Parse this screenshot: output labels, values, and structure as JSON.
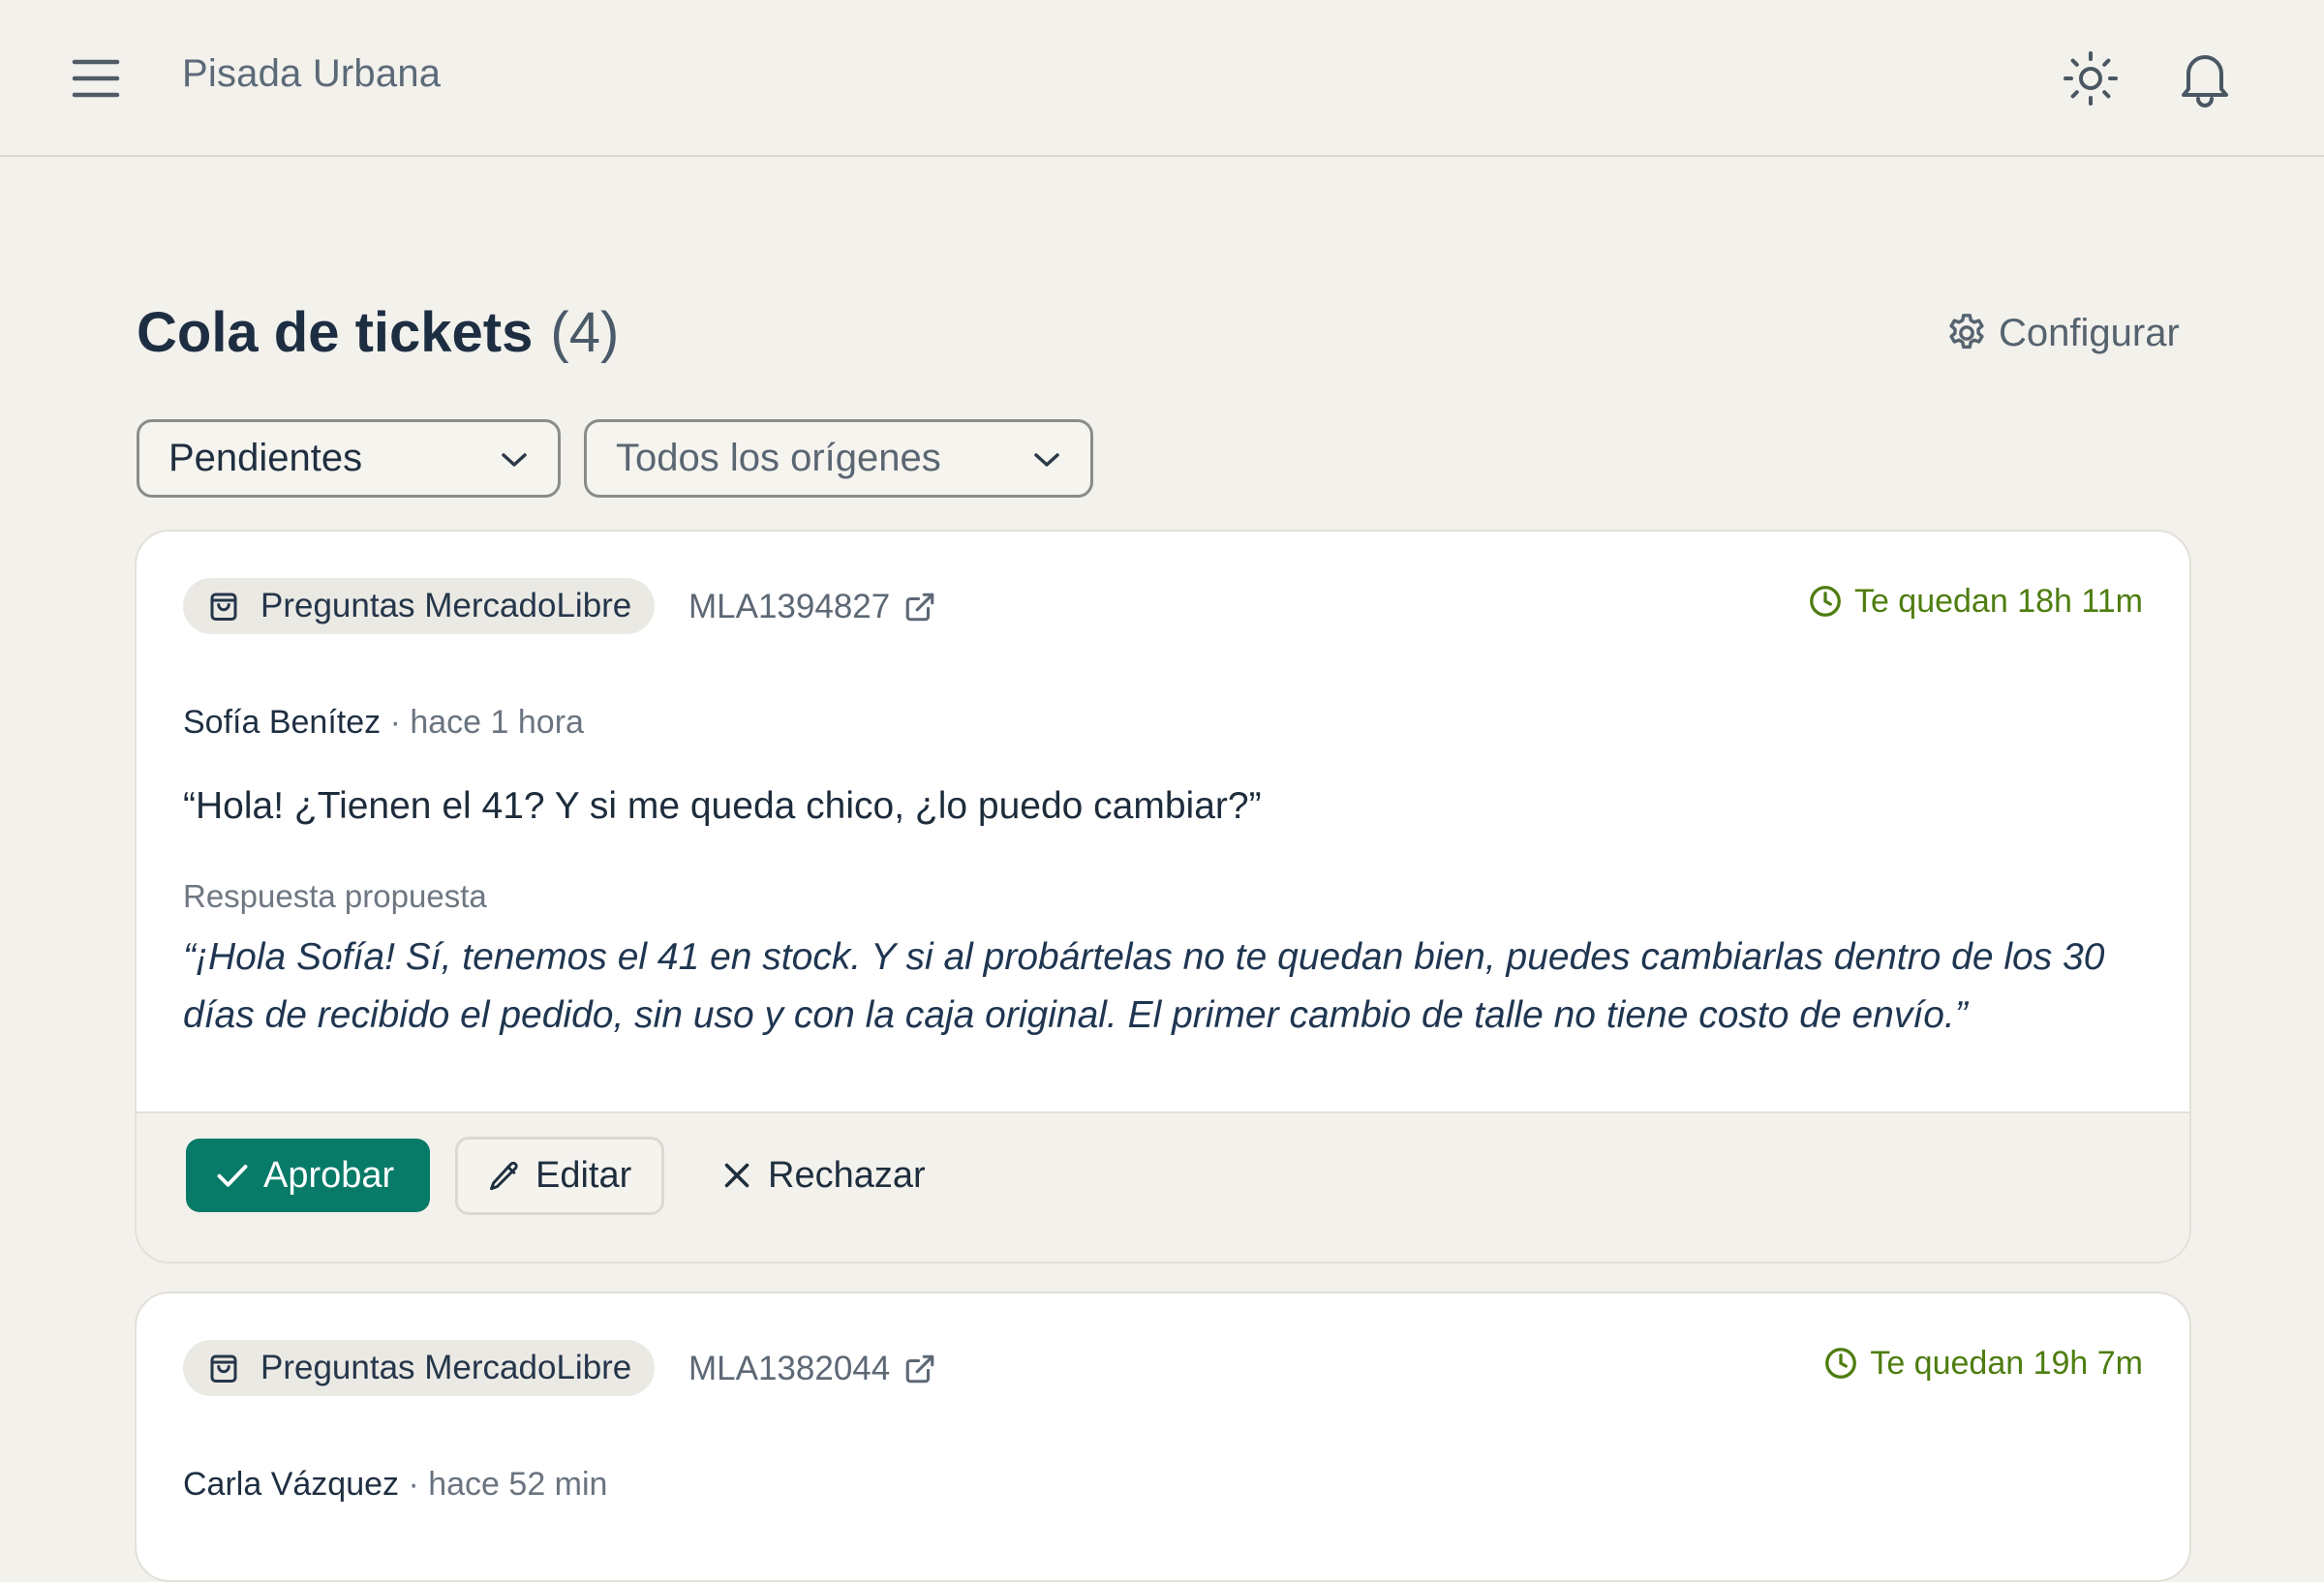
{
  "header": {
    "brand": "Pisada Urbana",
    "icons": [
      "menu-icon",
      "sun-icon",
      "bell-icon"
    ]
  },
  "page": {
    "title": "Cola de tickets",
    "count": "(4)",
    "config_label": "Configurar"
  },
  "filters": {
    "status": "Pendientes",
    "origin": "Todos los orígenes"
  },
  "tickets": [
    {
      "source": "Preguntas MercadoLibre",
      "item_id": "MLA1394827",
      "deadline": "Te quedan 18h 11m",
      "author": "Sofía Benítez",
      "time": "· hace 1 hora",
      "question": "“Hola! ¿Tienen el 41? Y si me queda chico, ¿lo puedo cambiar?”",
      "answer_label": "Respuesta propuesta",
      "answer": "“¡Hola Sofía! Sí, tenemos el 41 en stock. Y si al probártelas no te quedan bien, puedes cambiarlas dentro de los 30 días de recibido el pedido, sin uso y con la caja original. El primer cambio de talle no tiene costo de envío.”",
      "actions": {
        "approve": "Aprobar",
        "edit": "Editar",
        "reject": "Rechazar"
      }
    },
    {
      "source": "Preguntas MercadoLibre",
      "item_id": "MLA1382044",
      "deadline": "Te quedan 19h 7m",
      "author": "Carla Vázquez",
      "time": "· hace 52 min"
    }
  ],
  "colors": {
    "background": "#f3f1ec",
    "approve": "#087a68",
    "deadline": "#4e7d10",
    "title": "#1e2e42"
  }
}
